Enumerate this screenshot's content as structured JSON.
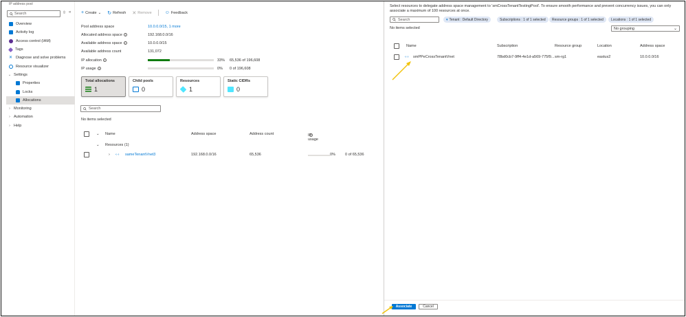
{
  "nav": {
    "breadcrumb": "IP address pool",
    "search_placeholder": "Search",
    "items": [
      {
        "label": "Overview",
        "color": "#0078d4"
      },
      {
        "label": "Activity log",
        "color": "#0078d4"
      },
      {
        "label": "Access control (IAM)",
        "color": "#5c2d91"
      },
      {
        "label": "Tags",
        "color": "#8661c5"
      },
      {
        "label": "Diagnose and solve problems",
        "color": "#0078d4"
      },
      {
        "label": "Resource visualizer",
        "color": "#0078d4"
      },
      {
        "label": "Settings"
      },
      {
        "label": "Properties",
        "color": "#0078d4"
      },
      {
        "label": "Locks",
        "color": "#0078d4"
      },
      {
        "label": "Allocations",
        "color": "#0078d4"
      },
      {
        "label": "Monitoring"
      },
      {
        "label": "Automation"
      },
      {
        "label": "Help"
      }
    ]
  },
  "toolbar": {
    "create": "Create",
    "refresh": "Refresh",
    "remove": "Remove",
    "feedback": "Feedback"
  },
  "properties": {
    "pool_label": "Pool address space",
    "pool_value": "10.0.0.0/15, 1 more",
    "allocated_label": "Allocated address space",
    "allocated_value": "192.168.0.0/16",
    "available_label": "Available address space",
    "available_value": "10.0.0.0/15",
    "count_label": "Available address count",
    "count_value": "131,072",
    "ip_alloc_label": "IP allocation",
    "ip_alloc_pct": "33%",
    "ip_alloc_count": "65,536 of 196,608",
    "ip_alloc_fraction": 0.33,
    "ip_usage_label": "IP usage",
    "ip_usage_pct": "0%",
    "ip_usage_count": "0 of 196,608",
    "ip_usage_fraction": 0.0
  },
  "cards": [
    {
      "title": "Total allocations",
      "value": "1"
    },
    {
      "title": "Child pools",
      "value": "0"
    },
    {
      "title": "Resources",
      "value": "1"
    },
    {
      "title": "Static CIDRs",
      "value": "0"
    }
  ],
  "main_grid": {
    "search_placeholder": "Search",
    "no_items": "No items selected",
    "headers": {
      "name": "Name",
      "address_space": "Address space",
      "address_count": "Address count",
      "ip_usage": "IP usage"
    },
    "group": "Resources (1)",
    "row": {
      "name": "sameTenantVnet3",
      "address_space": "192.168.0.0/16",
      "address_count": "65,536",
      "usage_pct": "0%",
      "usage_count": "0 of 65,536"
    }
  },
  "panel": {
    "description": "Select resources to delegate address space management to 'smCrossTenantTestingPool'. To ensure smooth performance and prevent concurrency issues, you can only associate a maximum of 100 resources at once.",
    "search_placeholder": "Search",
    "filters": {
      "tenant": "Tenant : Default Directory",
      "subscriptions": "Subscriptions : 1 of 1 selected",
      "resource_groups": "Resource groups : 1 of 1 selected",
      "locations": "Locations : 1 of 1 selected"
    },
    "no_items": "No items selected",
    "grouping": "No grouping",
    "headers": {
      "name": "Name",
      "subscription": "Subscription",
      "resource_group": "Resource group",
      "location": "Location",
      "address_space": "Address space"
    },
    "row": {
      "name": "smPPeCrossTenantVnet",
      "subscription": "78bd0cb7-9ff4-4e1d-a569-775f9...",
      "resource_group": "sm-rg1",
      "location": "eastus2",
      "address_space": "10.0.0.0/16"
    },
    "associate": "Associate",
    "cancel": "Cancel"
  },
  "colors": {
    "accent": "#0078d4",
    "progress": "#107c10",
    "annotation_arrow": "#f2c40f"
  }
}
